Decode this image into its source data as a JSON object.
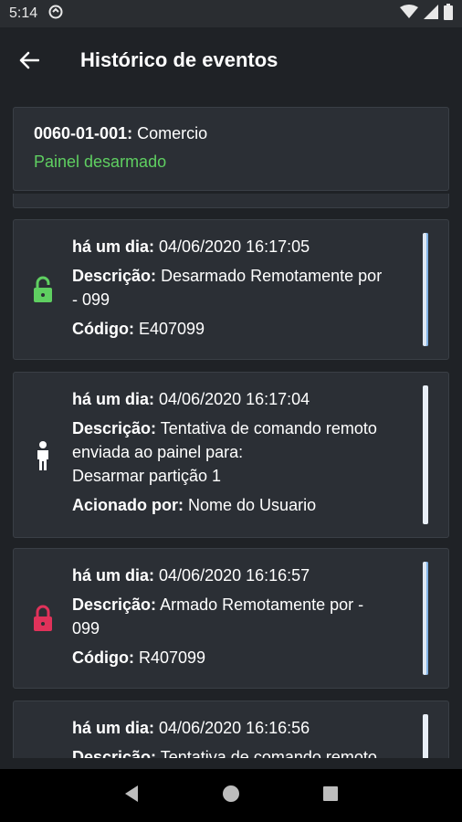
{
  "status": {
    "time": "5:14"
  },
  "header": {
    "title": "Histórico de eventos"
  },
  "account": {
    "code": "0060-01-001:",
    "name": "Comercio",
    "state": "Painel desarmado"
  },
  "events": [
    {
      "when_label": "há um dia:",
      "when_value": "04/06/2020 16:17:05",
      "desc_label": "Descrição:",
      "desc_value_1": "Desarmado Remotamente por",
      "desc_value_2": "- 099",
      "extra_label": "Código:",
      "extra_value": "E407099",
      "icon": "lock-open-icon",
      "icon_color": "#5fcf61"
    },
    {
      "when_label": "há um dia:",
      "when_value": "04/06/2020 16:17:04",
      "desc_label": "Descrição:",
      "desc_value_1": "Tentativa de comando remoto",
      "desc_value_2": "enviada ao painel para:",
      "desc_value_3": "Desarmar partição 1",
      "extra_label": "Acionado por:",
      "extra_value": "Nome do Usuario",
      "icon": "person-icon",
      "icon_color": "#ffffff"
    },
    {
      "when_label": "há um dia:",
      "when_value": "04/06/2020 16:16:57",
      "desc_label": "Descrição:",
      "desc_value_1": "Armado Remotamente por  -",
      "desc_value_2": "099",
      "extra_label": "Código:",
      "extra_value": "R407099",
      "icon": "lock-closed-icon",
      "icon_color": "#e0325a"
    },
    {
      "when_label": "há um dia:",
      "when_value": "04/06/2020 16:16:56",
      "desc_label": "Descrição:",
      "desc_value_1": "Tentativa de comando remoto"
    }
  ]
}
